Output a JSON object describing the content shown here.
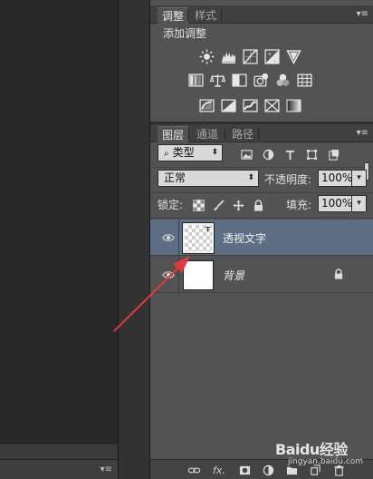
{
  "adjustments": {
    "tabs": [
      "调整",
      "样式"
    ],
    "title": "添加调整",
    "icons_row1": [
      "brightness-contrast-icon",
      "levels-icon",
      "curves-icon",
      "exposure-icon",
      "gradient-triangle-icon"
    ],
    "icons_row2": [
      "vibrance-icon",
      "color-balance-icon",
      "black-white-icon",
      "photo-filter-icon",
      "channel-mixer-icon",
      "color-lookup-icon"
    ],
    "icons_row3": [
      "invert-icon",
      "posterize-icon",
      "threshold-icon",
      "selective-color-icon",
      "gradient-map-icon"
    ]
  },
  "layers": {
    "tabs": [
      "图层",
      "通道",
      "路径"
    ],
    "filter_select": "类型",
    "filter_icons": [
      "image-filter-icon",
      "adjustment-filter-icon",
      "type-filter-icon",
      "shape-filter-icon",
      "smart-object-filter-icon"
    ],
    "blend_mode": "正常",
    "opacity_label": "不透明度:",
    "opacity_value": "100%",
    "lock_label": "锁定:",
    "fill_label": "填充:",
    "fill_value": "100%",
    "list": [
      {
        "name": "透视文字",
        "selected": true
      },
      {
        "name": "背景",
        "selected": false
      }
    ],
    "bottom_icons": [
      "link-icon",
      "fx-icon",
      "mask-icon",
      "adjustment-layer-icon",
      "folder-icon",
      "new-layer-icon",
      "trash-icon"
    ],
    "fx_label": "fx."
  },
  "watermark": {
    "logo": "Baidu经验",
    "sub": "jingyan.baidu.com"
  },
  "colors": {
    "panel_bg": "#535353",
    "selected_row": "#5e6f85",
    "annotation": "#e03a3a"
  }
}
